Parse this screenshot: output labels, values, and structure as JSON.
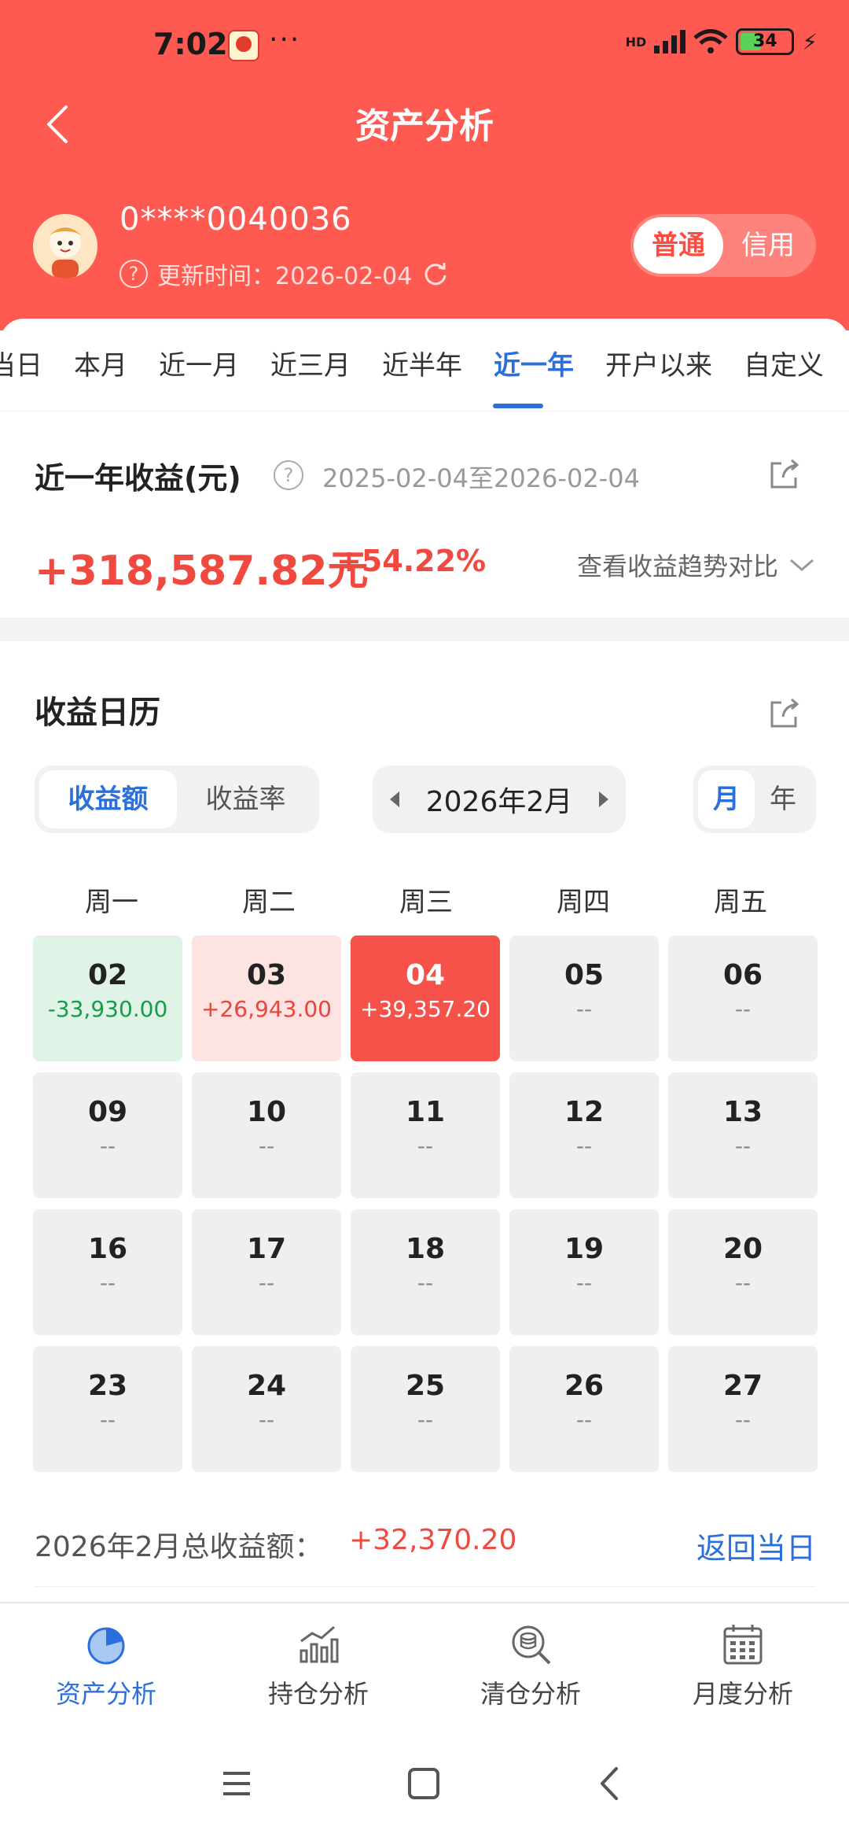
{
  "status_bar": {
    "time": "7:02",
    "dots": "···",
    "network": "HD",
    "battery": "34"
  },
  "header": {
    "title": "资产分析",
    "account": "0****0040036",
    "update_time": "更新时间：2026-02-04",
    "mode_options": [
      "普通",
      "信用"
    ]
  },
  "tabs": [
    "当日",
    "本月",
    "近一月",
    "近三月",
    "近半年",
    "近一年",
    "开户以来",
    "自定义"
  ],
  "summary": {
    "title": "近一年收益(元)",
    "range": "2025-02-04至2026-02-04",
    "amount": "+318,587.82元",
    "percent": "+54.22%",
    "compare": "查看收益趋势对比"
  },
  "calendar": {
    "title": "收益日历",
    "metric_options": [
      "收益额",
      "收益率"
    ],
    "month": "2026年2月",
    "period_options": [
      "月",
      "年"
    ],
    "weekdays": [
      "周一",
      "周二",
      "周三",
      "周四",
      "周五"
    ],
    "days": [
      {
        "d": "02",
        "v": "-33,930.00"
      },
      {
        "d": "03",
        "v": "+26,943.00"
      },
      {
        "d": "04",
        "v": "+39,357.20"
      },
      {
        "d": "05",
        "v": "--"
      },
      {
        "d": "06",
        "v": "--"
      },
      {
        "d": "09",
        "v": "--"
      },
      {
        "d": "10",
        "v": "--"
      },
      {
        "d": "11",
        "v": "--"
      },
      {
        "d": "12",
        "v": "--"
      },
      {
        "d": "13",
        "v": "--"
      },
      {
        "d": "16",
        "v": "--"
      },
      {
        "d": "17",
        "v": "--"
      },
      {
        "d": "18",
        "v": "--"
      },
      {
        "d": "19",
        "v": "--"
      },
      {
        "d": "20",
        "v": "--"
      },
      {
        "d": "23",
        "v": "--"
      },
      {
        "d": "24",
        "v": "--"
      },
      {
        "d": "25",
        "v": "--"
      },
      {
        "d": "26",
        "v": "--"
      },
      {
        "d": "27",
        "v": "--"
      }
    ],
    "total_label": "2026年2月总收益额：",
    "total_value": "+32,370.20",
    "back_today": "返回当日"
  },
  "bottom_nav": [
    "资产分析",
    "持仓分析",
    "清仓分析",
    "月度分析"
  ],
  "colors": {
    "header_red": "#ff5a52",
    "accent_blue": "#2a6fdb",
    "gain_red": "#f04a40",
    "loss_green": "#1a9b4a"
  }
}
